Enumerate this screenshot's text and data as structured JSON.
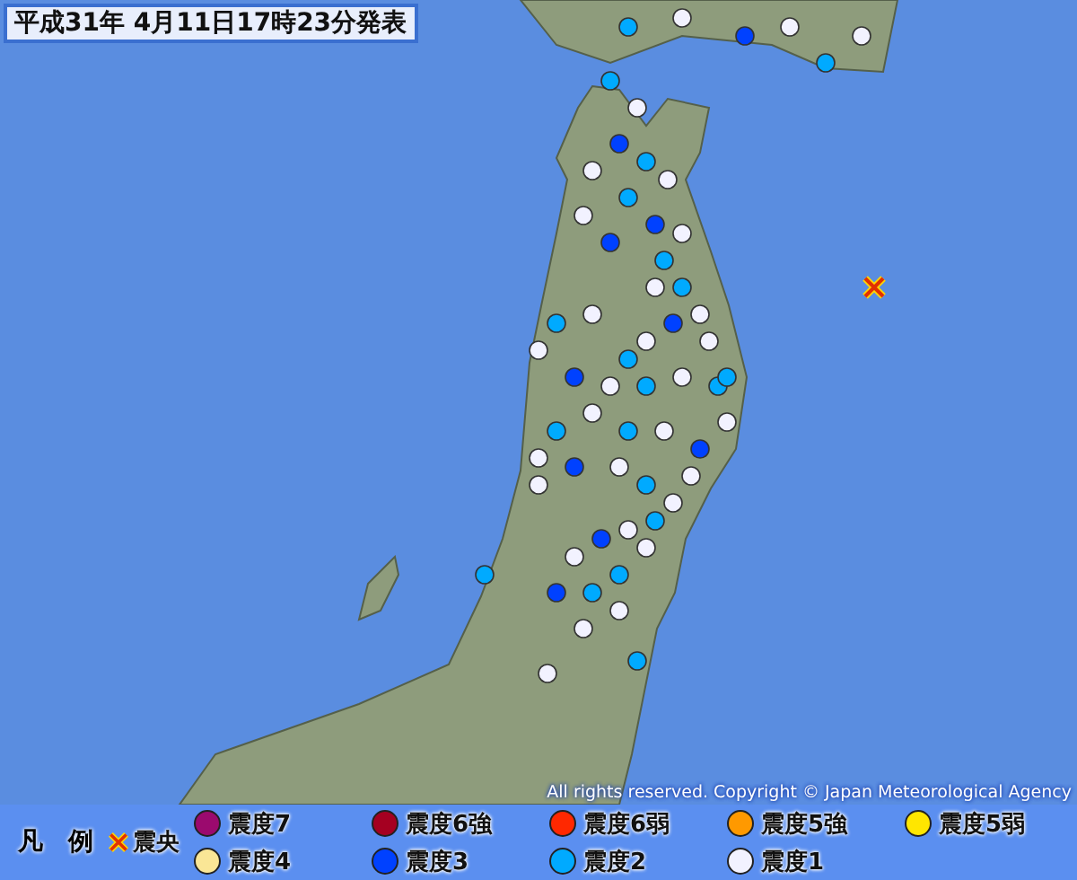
{
  "title": "平成31年 4月11日17時23分発表",
  "epicenter": {
    "kind": "epicenter"
  },
  "copyright": "All rights reserved. Copyright © Japan Meteorological Agency",
  "legend": {
    "title": "凡　例",
    "epicenter_label": "震央",
    "items": [
      {
        "label": "震度7",
        "color": "#9b0a6e"
      },
      {
        "label": "震度6強",
        "color": "#a50021"
      },
      {
        "label": "震度6弱",
        "color": "#ff2800"
      },
      {
        "label": "震度5強",
        "color": "#ff9900"
      },
      {
        "label": "震度5弱",
        "color": "#ffe600"
      },
      {
        "label": "震度4",
        "color": "#fae696"
      },
      {
        "label": "震度3",
        "color": "#0041ff"
      },
      {
        "label": "震度2",
        "color": "#00aaff"
      },
      {
        "label": "震度1",
        "color": "#f2f2ff"
      }
    ]
  }
}
